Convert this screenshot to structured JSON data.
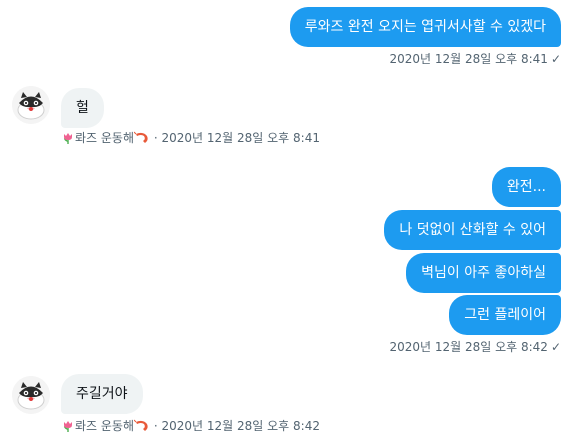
{
  "messages": [
    {
      "text": "루와즈 완전 오지는 엽귀서사할 수 있겠다"
    },
    {
      "text": "헐"
    },
    {
      "text": "완전..."
    },
    {
      "text": "나 덧없이 산화할 수 있어"
    },
    {
      "text": "벽님이 아주 좋아하실"
    },
    {
      "text": "그런 플레이어"
    },
    {
      "text": "주길거야"
    }
  ],
  "meta": {
    "sent_time_1": "2020년 12월 28일 오후 8:41",
    "sent_time_2": "2020년 12월 28일 오후 8:42",
    "recv_time_1": "2020년 12월 28일 오후 8:41",
    "recv_time_2": "2020년 12월 28일 오후 8:42",
    "sender_name": "롸즈 운동해",
    "separator": "·",
    "check_glyph": "✓"
  },
  "icons": {
    "read_receipt": "check-icon",
    "name_prefix": "tulip-icon",
    "name_suffix": "shrimp-icon",
    "avatar": "cat-avatar"
  },
  "colors": {
    "outgoing_bubble": "#1d9bf0",
    "incoming_bubble": "#eff3f4",
    "meta_text": "#536471"
  }
}
